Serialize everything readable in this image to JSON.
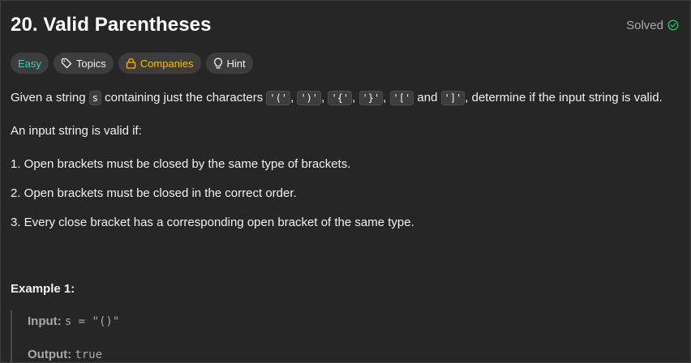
{
  "problem": {
    "title": "20. Valid Parentheses",
    "status": "Solved"
  },
  "tags": {
    "difficulty": "Easy",
    "topics": "Topics",
    "companies": "Companies",
    "hint": "Hint"
  },
  "icons": {
    "solved": "check-circle-icon",
    "topics": "tag-icon",
    "companies": "lock-icon",
    "hint": "lightbulb-icon"
  },
  "colors": {
    "background": "#262626",
    "easy": "#46c6c2",
    "companies": "#ffb700",
    "solved_check": "#2cbb5d"
  },
  "description": {
    "intro_prefix": "Given a string ",
    "intro_var": "s",
    "intro_middle": " containing just the characters ",
    "chars": [
      "'('",
      "')'",
      "'{'",
      "'}'",
      "'['",
      "']'"
    ],
    "sep": ", ",
    "and_text": " and ",
    "intro_suffix": ", determine if the input string is valid.",
    "valid_if": "An input string is valid if:",
    "rules": [
      "1. Open brackets must be closed by the same type of brackets.",
      "2. Open brackets must be closed in the correct order.",
      "3. Every close bracket has a corresponding open bracket of the same type."
    ]
  },
  "example": {
    "title": "Example 1:",
    "input_label": "Input:",
    "input_value": "s = \"()\"",
    "output_label": "Output:",
    "output_value": "true"
  }
}
